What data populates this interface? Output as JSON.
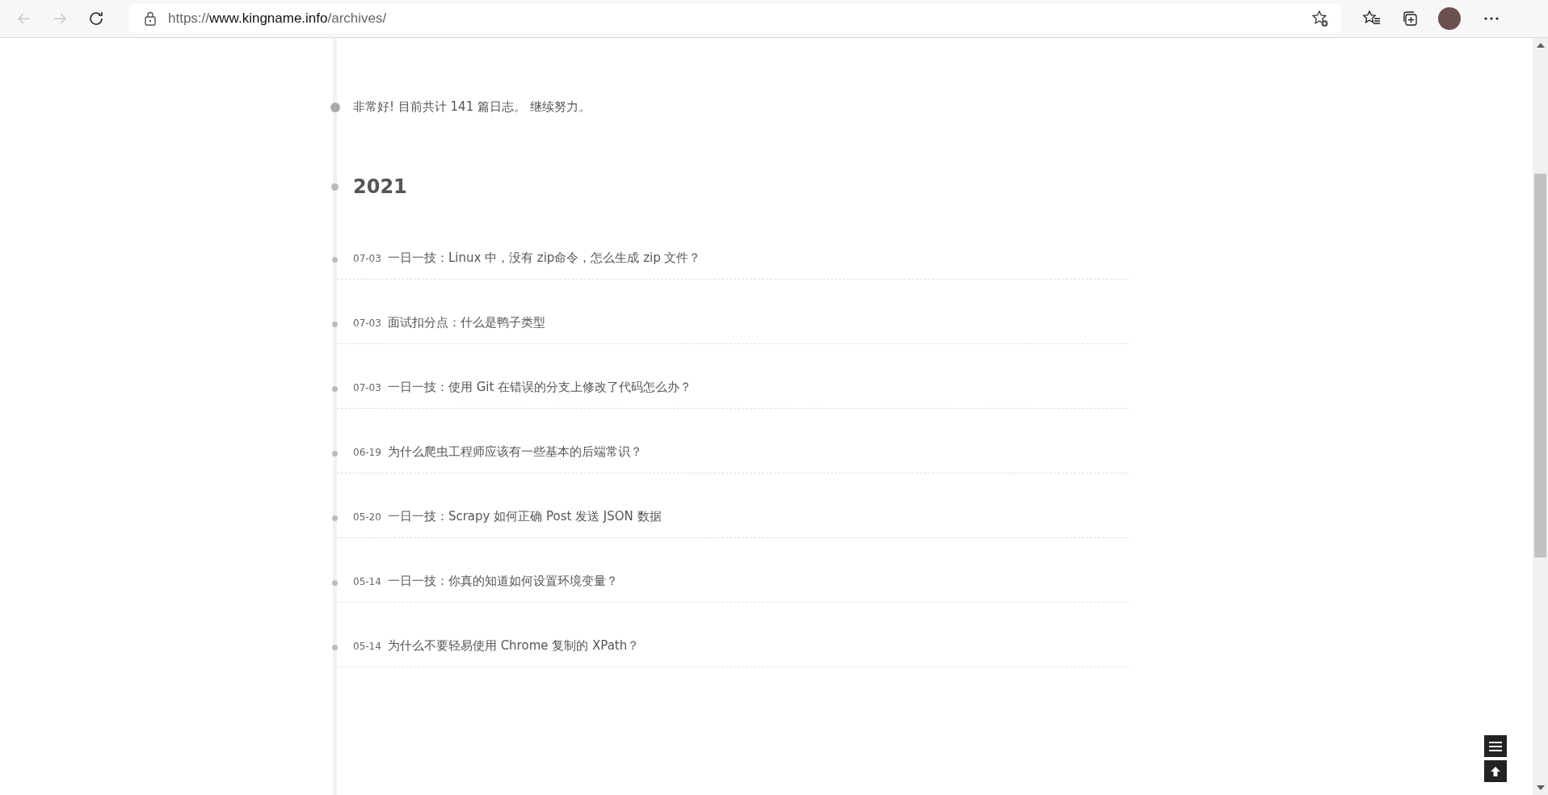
{
  "browser": {
    "url": {
      "scheme": "https://",
      "host": "www.kingname.info",
      "path": "/archives/"
    }
  },
  "archive": {
    "intro": "非常好! 目前共计 141 篇日志。 继续努力。",
    "year": "2021",
    "posts": [
      {
        "date": "07-03",
        "title": "一日一技：Linux 中，没有 zip命令，怎么生成 zip 文件？"
      },
      {
        "date": "07-03",
        "title": "面试扣分点：什么是鸭子类型"
      },
      {
        "date": "07-03",
        "title": "一日一技：使用 Git 在错误的分支上修改了代码怎么办？"
      },
      {
        "date": "06-19",
        "title": "为什么爬虫工程师应该有一些基本的后端常识？"
      },
      {
        "date": "05-20",
        "title": "一日一技：Scrapy 如何正确 Post 发送 JSON 数据"
      },
      {
        "date": "05-14",
        "title": "一日一技：你真的知道如何设置环境变量？"
      },
      {
        "date": "05-14",
        "title": "为什么不要轻易使用 Chrome 复制的 XPath？"
      }
    ]
  }
}
